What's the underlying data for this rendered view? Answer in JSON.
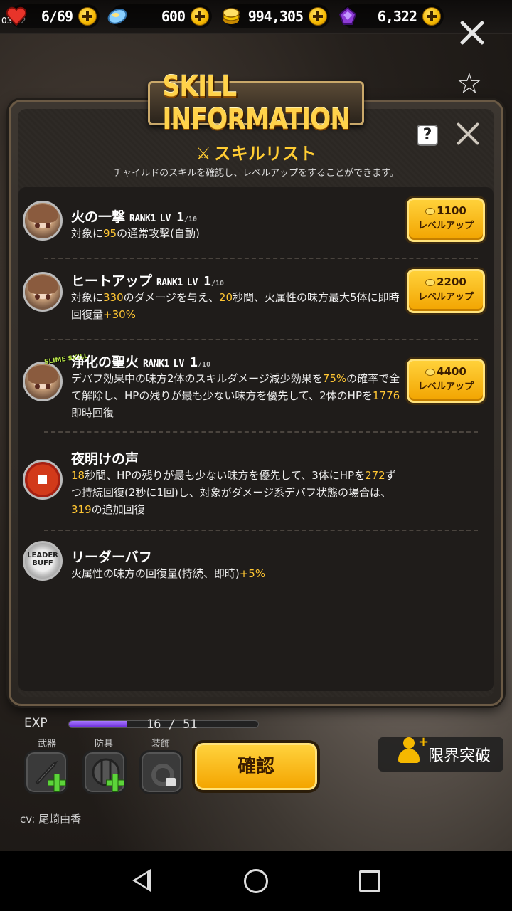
{
  "status_bar": {
    "time": "03:52"
  },
  "resources": [
    {
      "name": "stamina",
      "icon": "heart-icon",
      "value": "6/69",
      "color": "#e8342a"
    },
    {
      "name": "crystals",
      "icon": "crystal-icon",
      "value": "600",
      "color": "#8ad0ff"
    },
    {
      "name": "gold",
      "icon": "gold-coin-icon",
      "value": "994,305",
      "color": "#f5c400"
    },
    {
      "name": "gems",
      "icon": "purple-gem-icon",
      "value": "6,322",
      "color": "#8e3bd6"
    }
  ],
  "dialog": {
    "title": "SKILL INFORMATION",
    "help_label": "?",
    "subtitle": "スキルリスト",
    "description": "チャイルドのスキルを確認し、レベルアップをすることができます。"
  },
  "skills": [
    {
      "name": "火の一撃",
      "rank": "RANK1",
      "lv_label": "LV",
      "lv": "1",
      "lv_max": "/10",
      "parts": [
        "対象に",
        "95",
        "の通常攻撃(自動)"
      ],
      "cost": "1100",
      "button_label": "レベルアップ"
    },
    {
      "name": "ヒートアップ",
      "rank": "RANK1",
      "lv_label": "LV",
      "lv": "1",
      "lv_max": "/10",
      "parts": [
        "対象に",
        "330",
        "のダメージを与え、",
        "20",
        "秒間、火属性の味方最大5体に即時回復量",
        "+30%",
        ""
      ],
      "cost": "2200",
      "button_label": "レベルアップ"
    },
    {
      "name": "浄化の聖火",
      "rank": "RANK1",
      "lv_label": "LV",
      "lv": "1",
      "lv_max": "/10",
      "tag": "SLIME SKILL",
      "parts": [
        "デバフ効果中の味方2体のスキルダメージ減少効果を",
        "75%",
        "の確率で全て解除し、HPの残りが最も少ない味方を優先して、2体のHPを",
        "1776",
        "即時回復"
      ],
      "cost": "4400",
      "button_label": "レベルアップ"
    },
    {
      "name": "夜明けの声",
      "parts": [
        "",
        "18",
        "秒間、HPの残りが最も少ない味方を優先して、3体にHPを",
        "272",
        "ずつ持続回復(2秒に1回)し、対象がダメージ系デバフ状態の場合は、",
        "319",
        "の追加回復"
      ]
    },
    {
      "name": "リーダーバフ",
      "badge": "LEADER BUFF",
      "parts": [
        "火属性の味方の回復量(持続、即時)",
        "+5%",
        ""
      ]
    }
  ],
  "character": {
    "exp_label": "EXP",
    "exp_text": "16 / 51",
    "exp_fraction": 0.31,
    "equipment": [
      {
        "label": "武器",
        "icon": "dagger-icon"
      },
      {
        "label": "防具",
        "icon": "shield-icon"
      },
      {
        "label": "装飾",
        "icon": "ring-icon"
      }
    ],
    "confirm_label": "確認",
    "breakthrough_label": "限界突破",
    "cv": "cv: 尾崎由香"
  }
}
